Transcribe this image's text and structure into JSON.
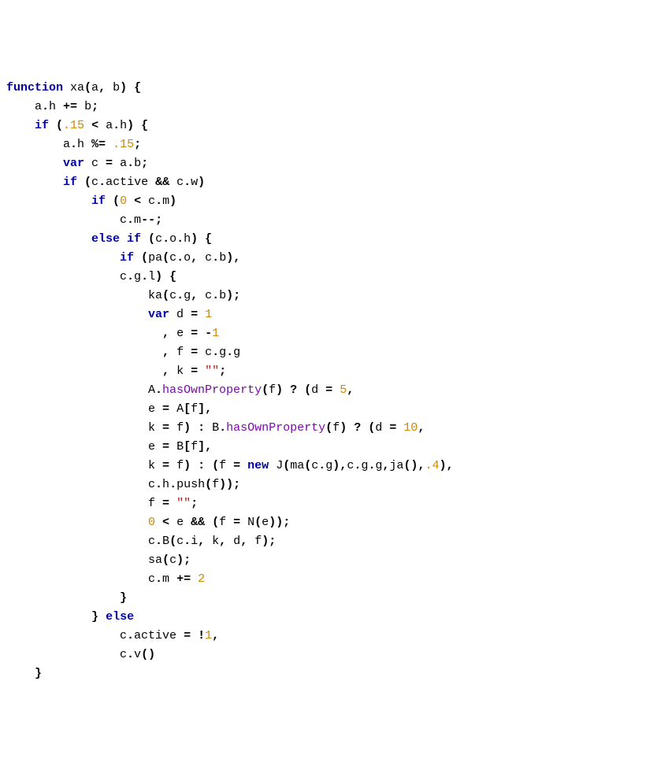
{
  "code": {
    "t1": "function",
    "t2": " xa",
    "t3": "(",
    "t4": "a",
    "t5": ",",
    "t6": " b",
    "t7": ")",
    "t8": " {",
    "l2a": "    a",
    "l2b": ".",
    "l2c": "h ",
    "l2d": "+=",
    "l2e": " b",
    "l2f": ";",
    "l3a": "    ",
    "l3b": "if",
    "l3c": " (",
    "l3d": ".15",
    "l3e": " <",
    "l3f": " a",
    "l3g": ".",
    "l3h": "h",
    "l3i": ")",
    "l3j": " {",
    "l4a": "        a",
    "l4b": ".",
    "l4c": "h ",
    "l4d": "%=",
    "l4e": " ",
    "l4f": ".15",
    "l4g": ";",
    "l5a": "        ",
    "l5b": "var",
    "l5c": " c ",
    "l5d": "=",
    "l5e": " a",
    "l5f": ".",
    "l5g": "b",
    "l5h": ";",
    "l6a": "        ",
    "l6b": "if",
    "l6c": " (",
    "l6d": "c",
    "l6e": ".",
    "l6f": "active ",
    "l6g": "&&",
    "l6h": " c",
    "l6i": ".",
    "l6j": "w",
    "l6k": ")",
    "l7a": "            ",
    "l7b": "if",
    "l7c": " (",
    "l7d": "0",
    "l7e": " <",
    "l7f": " c",
    "l7g": ".",
    "l7h": "m",
    "l7i": ")",
    "l8a": "                c",
    "l8b": ".",
    "l8c": "m",
    "l8d": "--;",
    "l9a": "            ",
    "l9b": "else if",
    "l9c": " (",
    "l9d": "c",
    "l9e": ".",
    "l9f": "o",
    "l9g": ".",
    "l9h": "h",
    "l9i": ")",
    "l9j": " {",
    "l10a": "                ",
    "l10b": "if",
    "l10c": " (",
    "l10d": "pa",
    "l10e": "(",
    "l10f": "c",
    "l10g": ".",
    "l10h": "o",
    "l10i": ",",
    "l10j": " c",
    "l10k": ".",
    "l10l": "b",
    "l10m": "),",
    "l11a": "                c",
    "l11b": ".",
    "l11c": "g",
    "l11d": ".",
    "l11e": "l",
    "l11f": ")",
    "l11g": " {",
    "l12a": "                    ka",
    "l12b": "(",
    "l12c": "c",
    "l12d": ".",
    "l12e": "g",
    "l12f": ",",
    "l12g": " c",
    "l12h": ".",
    "l12i": "b",
    "l12j": ");",
    "l13a": "                    ",
    "l13b": "var",
    "l13c": " d ",
    "l13d": "=",
    "l13e": " ",
    "l13f": "1",
    "l14a": "                      ",
    "l14b": ",",
    "l14c": " e ",
    "l14d": "=",
    "l14e": " ",
    "l14f": "-",
    "l14g": "1",
    "l15a": "                      ",
    "l15b": ",",
    "l15c": " f ",
    "l15d": "=",
    "l15e": " c",
    "l15f": ".",
    "l15g": "g",
    "l15h": ".",
    "l15i": "g",
    "l16a": "                      ",
    "l16b": ",",
    "l16c": " k ",
    "l16d": "=",
    "l16e": " ",
    "l16f": "\"\"",
    "l16g": ";",
    "l17a": "                    A",
    "l17b": ".",
    "l17c": "hasOwnProperty",
    "l17d": "(",
    "l17e": "f",
    "l17f": ")",
    "l17g": " ?",
    "l17h": " (",
    "l17i": "d ",
    "l17j": "=",
    "l17k": " ",
    "l17l": "5",
    "l17m": ",",
    "l18a": "                    e ",
    "l18b": "=",
    "l18c": " A",
    "l18d": "[",
    "l18e": "f",
    "l18f": "],",
    "l19a": "                    k ",
    "l19b": "=",
    "l19c": " f",
    "l19d": ")",
    "l19e": " :",
    "l19f": " B",
    "l19g": ".",
    "l19h": "hasOwnProperty",
    "l19i": "(",
    "l19j": "f",
    "l19k": ")",
    "l19l": " ?",
    "l19m": " (",
    "l19n": "d ",
    "l19o": "=",
    "l19p": " ",
    "l19q": "10",
    "l19r": ",",
    "l20a": "                    e ",
    "l20b": "=",
    "l20c": " B",
    "l20d": "[",
    "l20e": "f",
    "l20f": "],",
    "l21a": "                    k ",
    "l21b": "=",
    "l21c": " f",
    "l21d": ")",
    "l21e": " :",
    "l21f": " (",
    "l21g": "f ",
    "l21h": "=",
    "l21i": " ",
    "l21j": "new",
    "l21k": " J",
    "l21l": "(",
    "l21m": "ma",
    "l21n": "(",
    "l21o": "c",
    "l21p": ".",
    "l21q": "g",
    "l21r": "),",
    "l21s": "c",
    "l21t": ".",
    "l21u": "g",
    "l21v": ".",
    "l21w": "g",
    "l21x": ",",
    "l21y": "ja",
    "l21z": "(),",
    "l21aa": ".4",
    "l21ab": "),",
    "l22a": "                    c",
    "l22b": ".",
    "l22c": "h",
    "l22d": ".",
    "l22e": "push",
    "l22f": "(",
    "l22g": "f",
    "l22h": "));",
    "l23a": "                    f ",
    "l23b": "=",
    "l23c": " ",
    "l23d": "\"\"",
    "l23e": ";",
    "l24a": "                    ",
    "l24b": "0",
    "l24c": " <",
    "l24d": " e ",
    "l24e": "&&",
    "l24f": " (",
    "l24g": "f ",
    "l24h": "=",
    "l24i": " N",
    "l24j": "(",
    "l24k": "e",
    "l24l": "));",
    "l25a": "                    c",
    "l25b": ".",
    "l25c": "B",
    "l25d": "(",
    "l25e": "c",
    "l25f": ".",
    "l25g": "i",
    "l25h": ",",
    "l25i": " k",
    "l25j": ",",
    "l25k": " d",
    "l25l": ",",
    "l25m": " f",
    "l25n": ");",
    "l26a": "                    sa",
    "l26b": "(",
    "l26c": "c",
    "l26d": ");",
    "l27a": "                    c",
    "l27b": ".",
    "l27c": "m ",
    "l27d": "+=",
    "l27e": " ",
    "l27f": "2",
    "l28a": "                ",
    "l28b": "}",
    "l29a": "            ",
    "l29b": "}",
    "l29c": " ",
    "l29d": "else",
    "l30a": "                c",
    "l30b": ".",
    "l30c": "active ",
    "l30d": "=",
    "l30e": " ",
    "l30f": "!",
    "l30g": "1",
    "l30h": ",",
    "l31a": "                c",
    "l31b": ".",
    "l31c": "v",
    "l31d": "()",
    "l32a": "    ",
    "l32b": "}"
  }
}
